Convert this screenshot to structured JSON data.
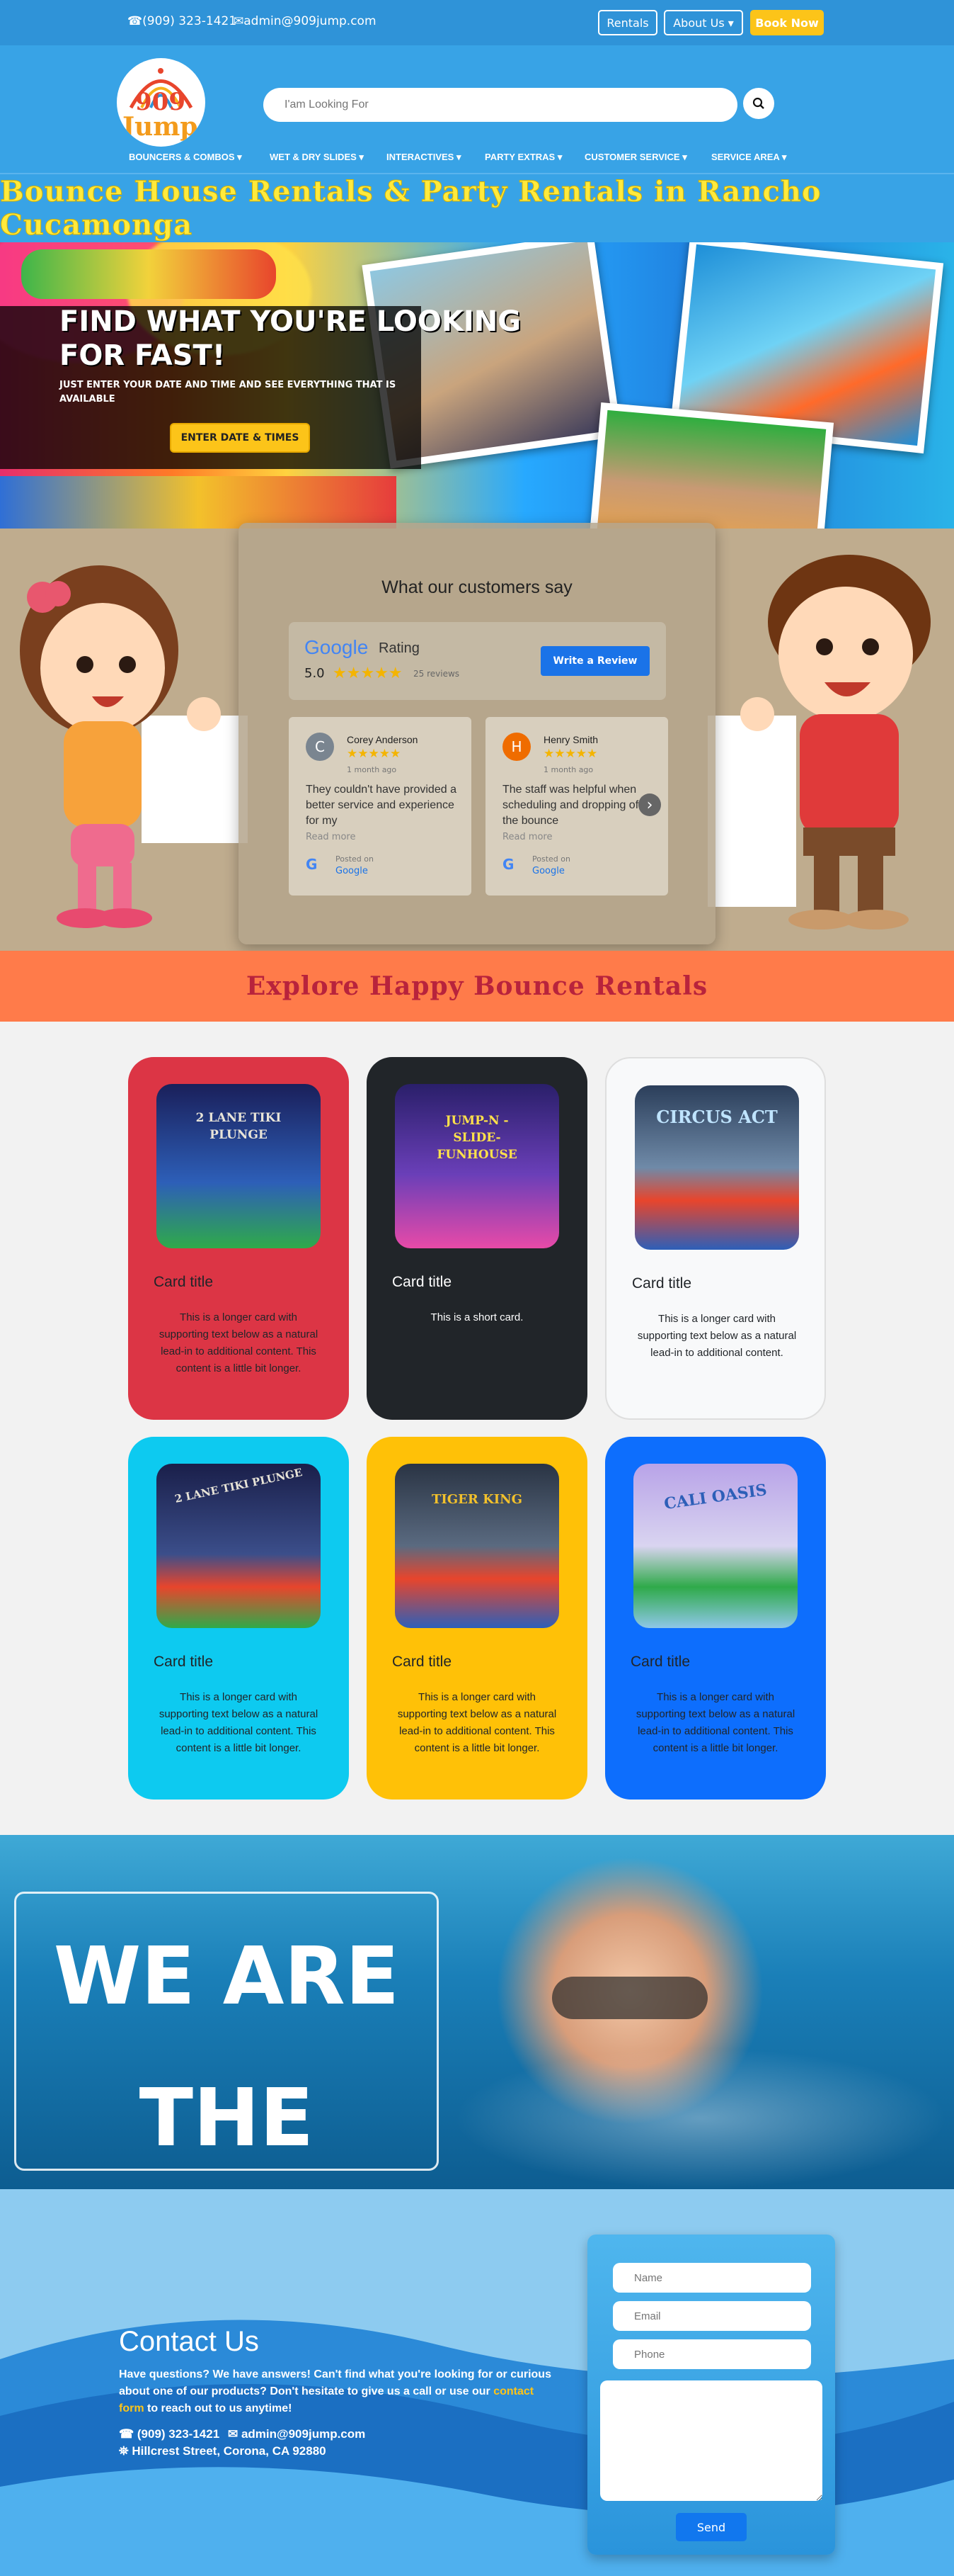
{
  "topbar": {
    "phone": "☎(909) 323-1421",
    "email": "✉admin@909jump.com",
    "rentals": "Rentals",
    "about": "About Us ▾",
    "book": "Book Now"
  },
  "header": {
    "logo_text_top": "909",
    "logo_text_bottom": "Jump",
    "search_placeholder": "I'am Looking For"
  },
  "nav": [
    "BOUNCERS & COMBOS ▾",
    "WET & DRY SLIDES ▾",
    "INTERACTIVES ▾",
    "PARTY EXTRAS ▾",
    "CUSTOMER SERVICE ▾",
    "SERVICE AREA ▾"
  ],
  "banner": {
    "title": "Bounce House Rentals & Party Rentals in Rancho Cucamonga"
  },
  "hero": {
    "heading_line1": "FIND WHAT YOU'RE LOOKING",
    "heading_line2": "FOR FAST!",
    "sub": "JUST ENTER YOUR DATE AND TIME AND SEE EVERYTHING THAT IS AVAILABLE",
    "button": "ENTER DATE & TIMES"
  },
  "testimonials": {
    "title": "What our customers say",
    "google_word": "Google",
    "rating_word": "Rating",
    "score": "5.0",
    "stars": "★★★★★",
    "count": "25 reviews",
    "write_btn": "Write a Review",
    "reviews": [
      {
        "initial": "C",
        "name": "Corey Anderson",
        "time": "1 month ago",
        "stars": "★★★★★",
        "text": "They couldn't have provided a better service and experience for my",
        "more": "Read more",
        "posted": "Posted on",
        "source": "Google",
        "color": "#7a8590"
      },
      {
        "initial": "H",
        "name": "Henry Smith",
        "time": "1 month ago",
        "stars": "★★★★★",
        "text": "The staff was helpful when scheduling and dropping off the bounce",
        "more": "Read more",
        "posted": "Posted on",
        "source": "Google",
        "color": "#ef6c00"
      }
    ],
    "next_icon": "›"
  },
  "explore": {
    "title": "Explore Happy Bounce Rentals"
  },
  "cards": [
    {
      "img_label": "2 LANE TIKI PLUNGE",
      "title": "Card title",
      "text": "This is a longer card with supporting text below as a natural lead-in to additional content. This content is a little bit longer.",
      "bg": "#dc3545",
      "fg": "#212529"
    },
    {
      "img_label": "JUMP-N -SLIDE- FUNHOUSE",
      "title": "Card title",
      "text": "This is a short card.",
      "bg": "#212529",
      "fg": "#ffffff"
    },
    {
      "img_label": "CIRCUS ACT",
      "title": "Card title",
      "text": "This is a longer card with supporting text below as a natural lead-in to additional content.",
      "bg": "#f8f9fa",
      "fg": "#212529"
    },
    {
      "img_label": "2 LANE TIKI PLUNGE",
      "title": "Card title",
      "text": "This is a longer card with supporting text below as a natural lead-in to additional content. This content is a little bit longer.",
      "bg": "#0dcaf0",
      "fg": "#212529"
    },
    {
      "img_label": "TIGER KING",
      "title": "Card title",
      "text": "This is a longer card with supporting text below as a natural lead-in to additional content. This content is a little bit longer.",
      "bg": "#ffc107",
      "fg": "#212529"
    },
    {
      "img_label": "CALI OASIS",
      "title": "Card title",
      "text": "This is a longer card with supporting text below as a natural lead-in to additional content. This content is a little bit longer.",
      "bg": "#0d6efd",
      "fg": "#212529"
    }
  ],
  "best": {
    "line1": "WE ARE",
    "line2": "THE BEST"
  },
  "contact": {
    "title": "Contact Us",
    "text_before": "Have questions? We have answers! Can't find what you're looking for or curious about one of our products? Don't hesitate to give us a call or use our ",
    "link": "contact form",
    "text_after": " to reach out to us anytime!",
    "phone": "☎ (909) 323-1421",
    "email": "✉ admin@909jump.com",
    "address": "⛯ Hillcrest Street, Corona, CA 92880",
    "name_ph": "Name",
    "email_ph": "Email",
    "phone_ph": "Phone",
    "send": "Send"
  },
  "colors": {
    "brand_blue": "#38a3e6",
    "accent_yellow": "#fcc419",
    "banner_title": "#ffea3d",
    "explore_bg": "#ff7b4a"
  }
}
